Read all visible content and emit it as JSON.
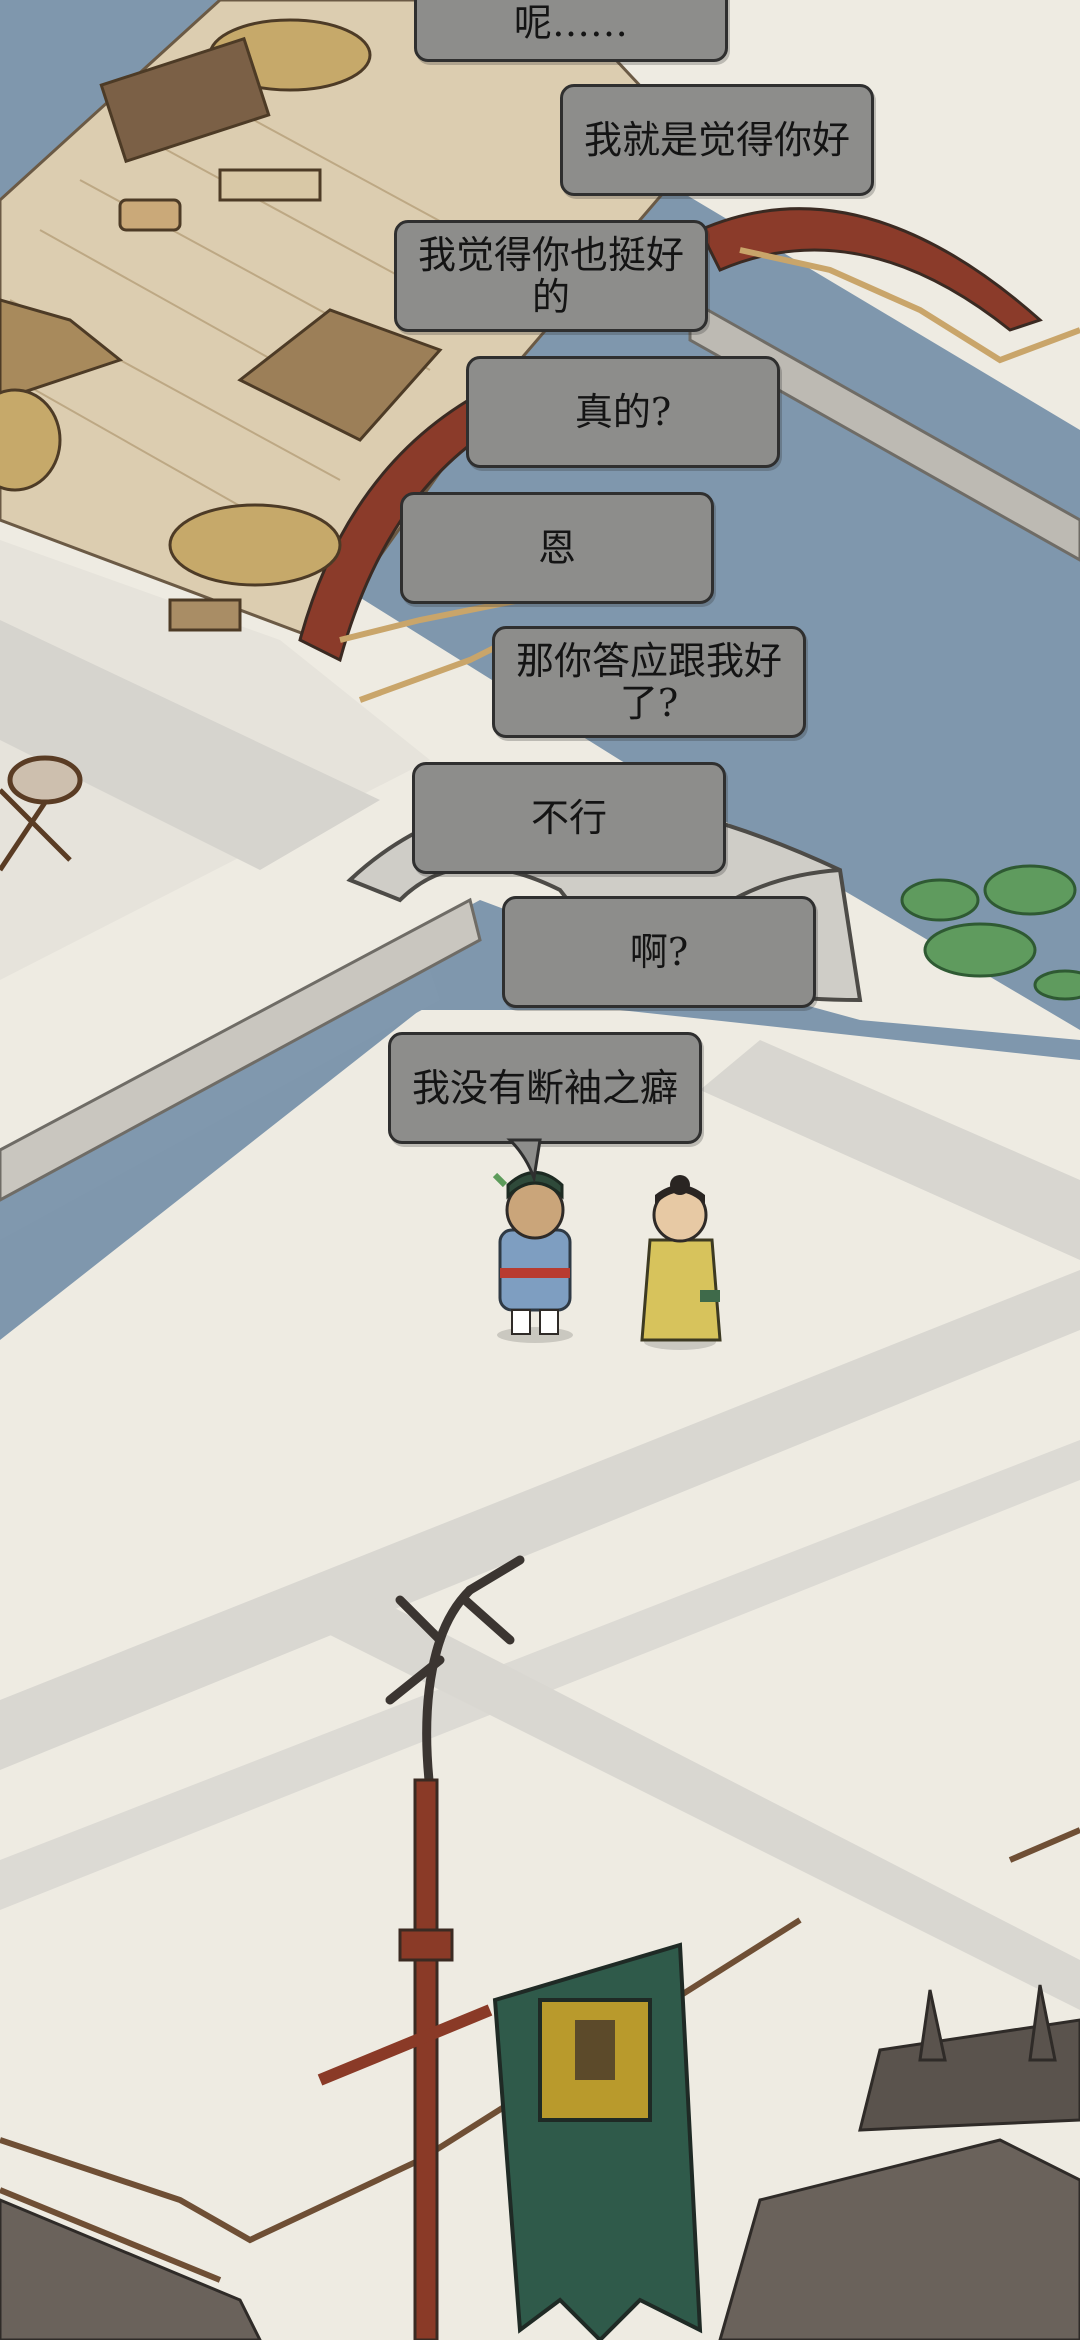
{
  "dialogue": [
    {
      "id": "line-1",
      "text": "呢……"
    },
    {
      "id": "line-2",
      "text": "我就是觉得你好"
    },
    {
      "id": "line-3",
      "text": "我觉得你也挺好的"
    },
    {
      "id": "line-4",
      "text": "真的?"
    },
    {
      "id": "line-5",
      "text": "恩"
    },
    {
      "id": "line-6",
      "text": "那你答应跟我好了?"
    },
    {
      "id": "line-7",
      "text": "不行"
    },
    {
      "id": "line-8",
      "text": "啊?"
    },
    {
      "id": "line-9",
      "text": "我没有断袖之癖"
    }
  ],
  "characters": [
    {
      "name": "guard-character",
      "robe_color": "#7e9ec1"
    },
    {
      "name": "scholar-character",
      "robe_color": "#d7c35c"
    }
  ],
  "colors": {
    "water": "#7f97ad",
    "ground": "#eeebe2",
    "paving": "#d8d6d0",
    "wood": "#d9c7a6",
    "bridge_red": "#8b3b2a",
    "bubble_fill": "#8d8d8b",
    "banner": "#b99a2c"
  }
}
